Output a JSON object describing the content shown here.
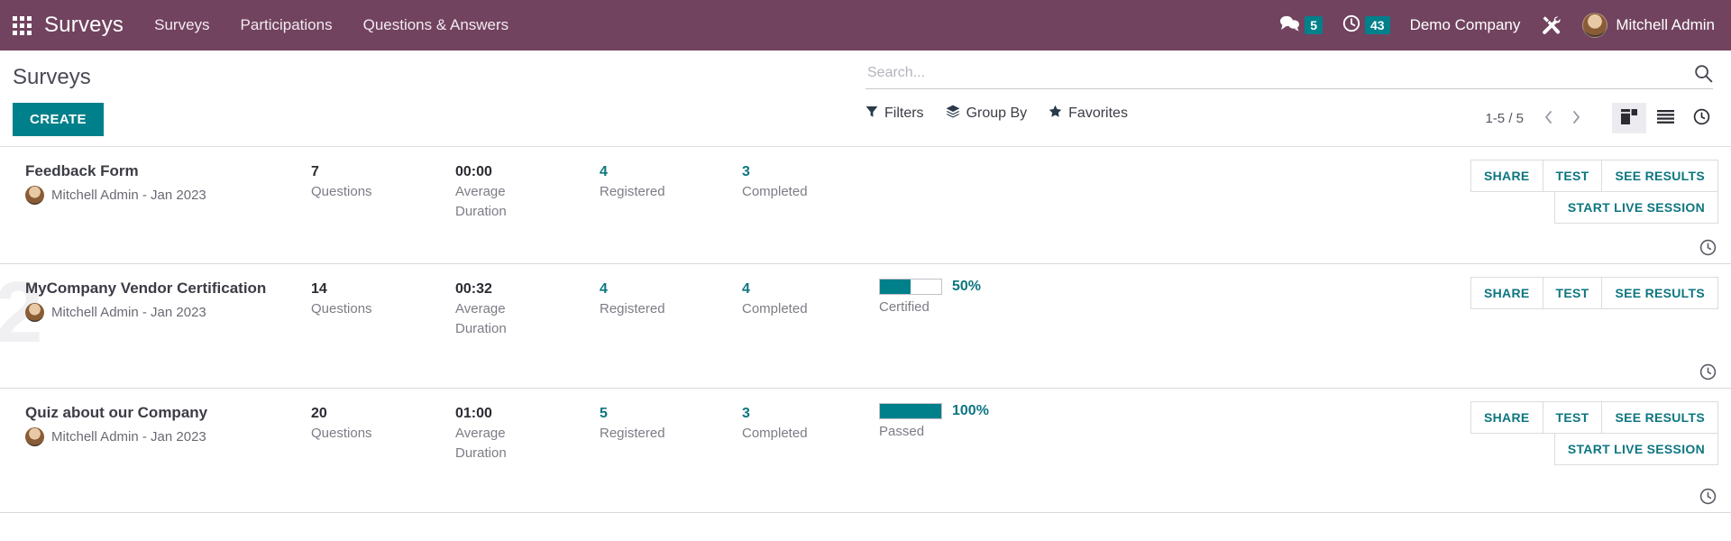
{
  "navbar": {
    "apps_icon": "apps-grid-icon",
    "brand": "Surveys",
    "menu": [
      {
        "label": "Surveys"
      },
      {
        "label": "Participations"
      },
      {
        "label": "Questions & Answers"
      }
    ],
    "messages": {
      "icon": "messages-icon",
      "count": "5"
    },
    "activities": {
      "icon": "clock-icon",
      "count": "43"
    },
    "company": "Demo Company",
    "tools_icon": "tools-icon",
    "user": {
      "avatar": "user-avatar",
      "name": "Mitchell Admin"
    }
  },
  "control_panel": {
    "title": "Surveys",
    "create_label": "CREATE",
    "search": {
      "placeholder": "Search...",
      "value": "",
      "icon": "search-icon"
    },
    "filters": [
      {
        "label": "Filters",
        "icon": "funnel-icon"
      },
      {
        "label": "Group By",
        "icon": "layers-icon"
      },
      {
        "label": "Favorites",
        "icon": "star-icon"
      }
    ],
    "pager": {
      "range": "1-5 / 5",
      "prev_icon": "chevron-left-icon",
      "next_icon": "chevron-right-icon"
    },
    "views": [
      {
        "name": "kanban",
        "icon": "kanban-icon",
        "active": true
      },
      {
        "name": "list",
        "icon": "list-icon",
        "active": false
      },
      {
        "name": "activity",
        "icon": "activity-clock-icon",
        "active": false
      }
    ]
  },
  "labels": {
    "questions": "Questions",
    "average_duration": "Average Duration",
    "registered": "Registered",
    "completed": "Completed",
    "share": "SHARE",
    "test": "TEST",
    "see_results": "SEE RESULTS",
    "start_live_session": "START LIVE SESSION"
  },
  "rows": [
    {
      "title": "Feedback Form",
      "author": "Mitchell Admin - Jan 2023",
      "questions": "7",
      "duration": "00:00",
      "registered": "4",
      "completed": "3",
      "has_progress": false,
      "progress_pct": "",
      "progress_value": 0,
      "progress_label": "",
      "has_live_session": true,
      "watermark": ""
    },
    {
      "title": "MyCompany Vendor Certification",
      "author": "Mitchell Admin - Jan 2023",
      "questions": "14",
      "duration": "00:32",
      "registered": "4",
      "completed": "4",
      "has_progress": true,
      "progress_pct": "50%",
      "progress_value": 50,
      "progress_label": "Certified",
      "has_live_session": false,
      "watermark": "2"
    },
    {
      "title": "Quiz about our Company",
      "author": "Mitchell Admin - Jan 2023",
      "questions": "20",
      "duration": "01:00",
      "registered": "5",
      "completed": "3",
      "has_progress": true,
      "progress_pct": "100%",
      "progress_value": 100,
      "progress_label": "Passed",
      "has_live_session": true,
      "watermark": ""
    }
  ],
  "colors": {
    "navbar": "#71435f",
    "accent_teal": "#00808a",
    "link_teal": "#0d7680"
  }
}
